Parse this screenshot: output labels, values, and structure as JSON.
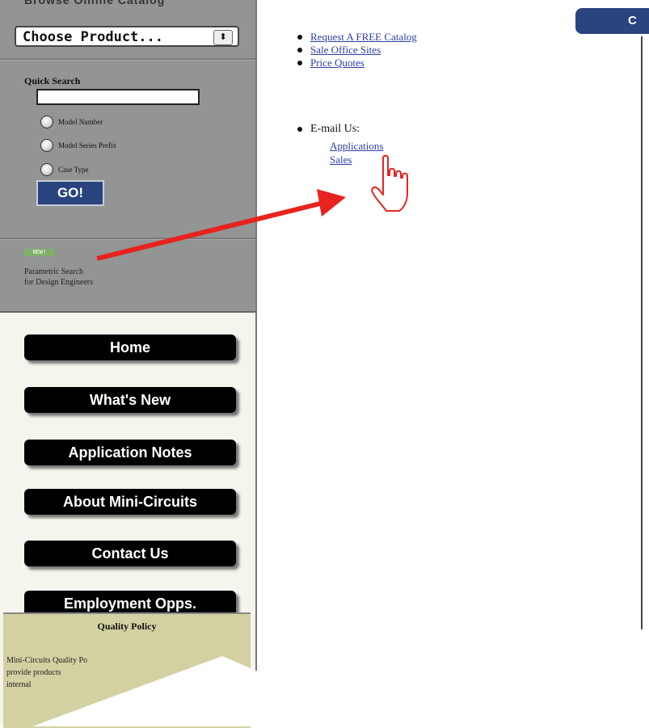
{
  "sidebar": {
    "cutoff_title": "Browse Online Catalog",
    "product_select": {
      "value": "Choose Product...",
      "arrow": "⬍"
    },
    "quick_search": {
      "label": "Quick Search",
      "input_value": "",
      "options": [
        "Model Number",
        "Model Series Prefix",
        "Case Type"
      ],
      "go_label": "GO!"
    },
    "parametric": {
      "badge": "NEW!",
      "line1": "Parametric Search",
      "line2": "for Design Engineers"
    },
    "nav": [
      "Home",
      "What's New",
      "Application Notes",
      "About Mini-Circuits",
      "Contact Us",
      "Employment Opps."
    ],
    "quality": {
      "title": "Quality Policy",
      "text": "Mini-Circuits Quality Po\nprovide products\ninternal"
    }
  },
  "main": {
    "top_tab_label": "C",
    "links": [
      "Request A FREE Catalog",
      "Sale Office Sites",
      "Price Quotes"
    ],
    "email": {
      "label": "E-mail Us:",
      "links": [
        "Applications",
        "Sales"
      ]
    }
  },
  "colors": {
    "sidebar_gray": "#939595",
    "nav_bg": "#000000",
    "accent_blue": "#29447e",
    "arrow_red": "#e8231f",
    "quality_bg": "#d3d1a2"
  }
}
